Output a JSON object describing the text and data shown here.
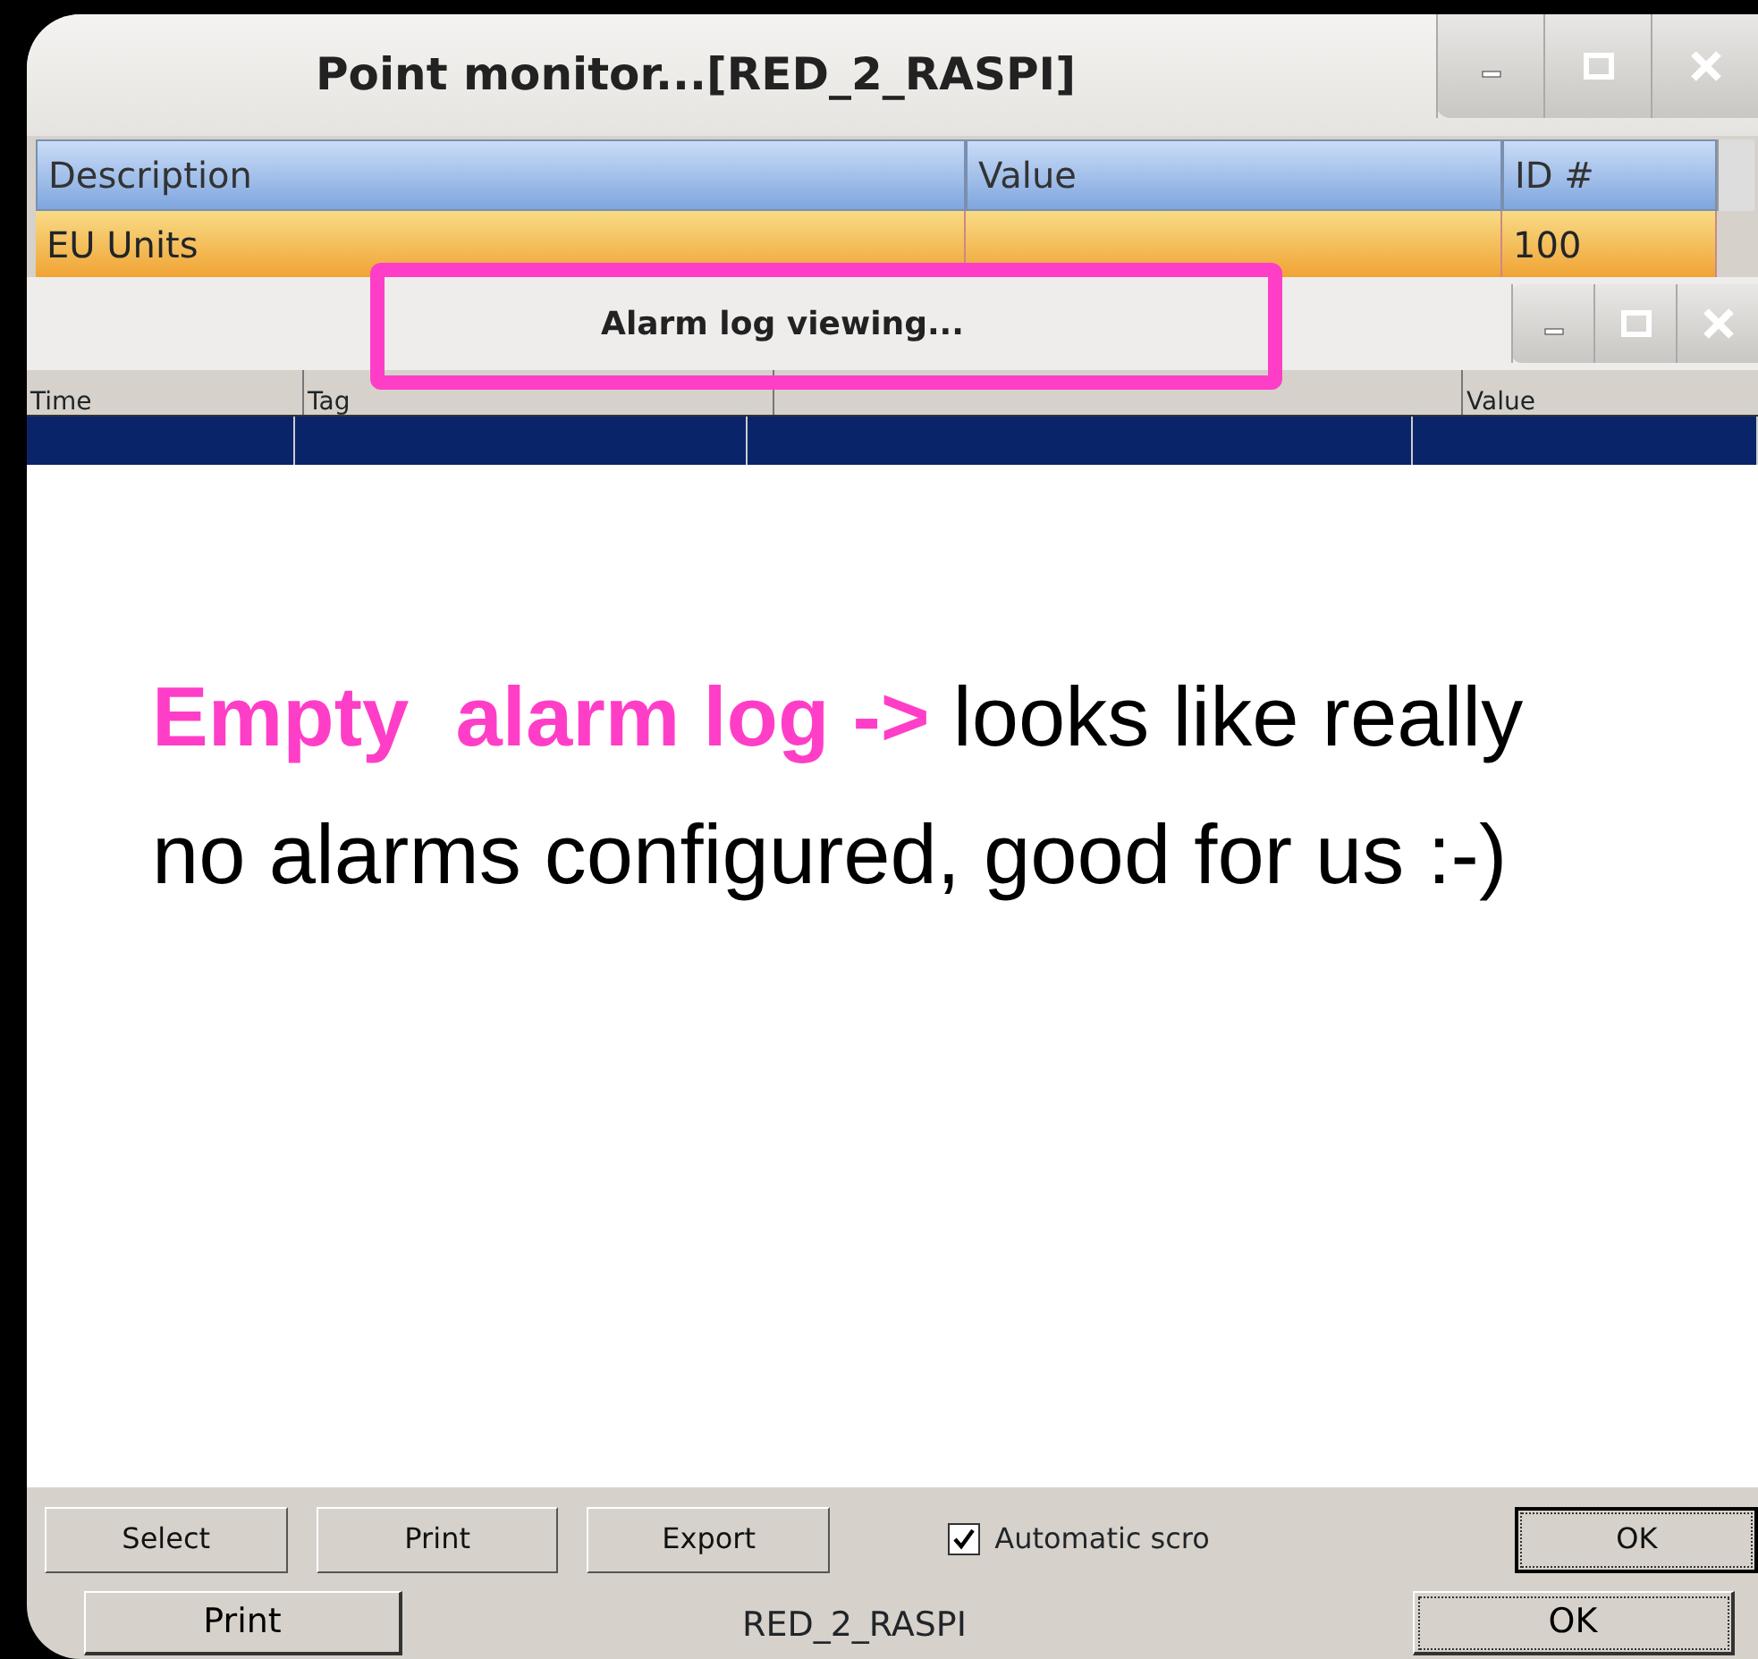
{
  "point_monitor": {
    "title": "Point monitor...[RED_2_RASPI]",
    "columns": [
      "Description",
      "Value",
      "ID #"
    ],
    "rows": [
      {
        "description": "EU Units",
        "id": "100",
        "selected": true
      }
    ],
    "print_button": "Print",
    "status": "RED_2_RASPI",
    "ok_button": "OK"
  },
  "alarm_log": {
    "title": "Alarm log viewing...",
    "columns": [
      {
        "label": "Time"
      },
      {
        "label": "Tag"
      },
      {},
      {
        "label": "Value"
      }
    ],
    "rows": [
      {
        "selected": true
      }
    ],
    "buttons": [
      "Select",
      "Print",
      "Export"
    ],
    "checkbox": {
      "label": "Automatic scro",
      "checked": true
    },
    "ok_button": "OK"
  },
  "annotation": {
    "text": "**Empty  alarm log ->** looks like really no alarms configured, good for us :-)"
  }
}
